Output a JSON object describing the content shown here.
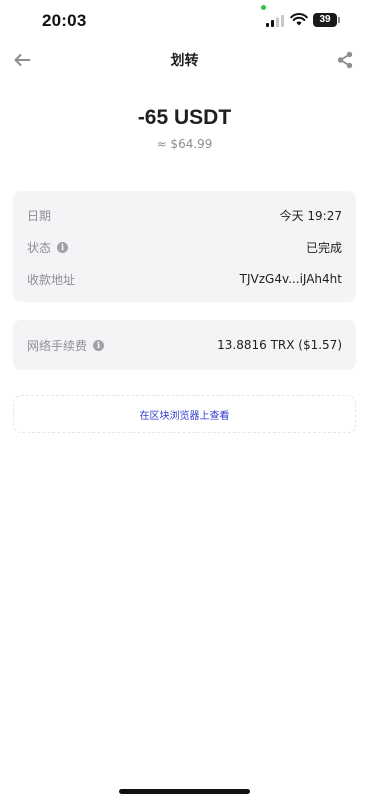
{
  "status_bar": {
    "time": "20:03",
    "battery": "39"
  },
  "nav": {
    "title": "划转",
    "back_icon": "arrow-left-icon",
    "share_icon": "share-icon"
  },
  "transaction": {
    "amount": "-65 USDT",
    "fiat": "≈ $64.99"
  },
  "details": [
    {
      "label": "日期",
      "value": "今天 19:27",
      "info": false
    },
    {
      "label": "状态",
      "value": "已完成",
      "info": true
    },
    {
      "label": "收款地址",
      "value": "TJVzG4v...iJAh4ht",
      "info": false
    }
  ],
  "fee": {
    "label": "网络手续费",
    "value": "13.8816 TRX ($1.57)"
  },
  "explorer_link": "在区块浏览器上查看",
  "colors": {
    "link": "#2f3ed1",
    "card_bg": "#f3f4f6",
    "muted": "#8e8e93"
  }
}
